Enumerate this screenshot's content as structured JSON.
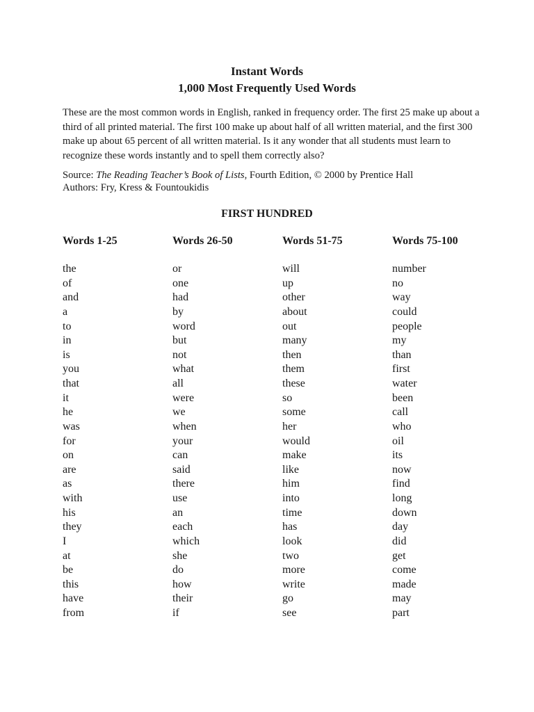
{
  "header": {
    "title": "Instant Words",
    "subtitle": "1,000 Most Frequently Used Words"
  },
  "intro": {
    "text": "These are the most common words in English, ranked in frequency order.  The first 25 make up about a third of all printed material.  The first 100 make up about half of all written material, and the first 300 make up about 65 percent of all written material.  Is it any wonder that all students must learn to recognize these words instantly and to spell them correctly also?"
  },
  "source": {
    "label": "Source: ",
    "book_title": "The Reading Teacher’s Book of Lists",
    "details": ", Fourth Edition, © 2000 by Prentice Hall",
    "authors": "Authors: Fry, Kress & Fountoukidis"
  },
  "section": {
    "title": "FIRST HUNDRED",
    "columns": [
      {
        "header": "Words 1-25",
        "words": [
          "the",
          "of",
          "and",
          "a",
          "to",
          "in",
          "is",
          "you",
          "that",
          "it",
          "he",
          "was",
          "for",
          "on",
          "are",
          "as",
          "with",
          "his",
          "they",
          "I",
          "at",
          "be",
          "this",
          "have",
          "from"
        ]
      },
      {
        "header": "Words 26-50",
        "words": [
          "or",
          "one",
          "had",
          "by",
          "word",
          "but",
          "not",
          "what",
          "all",
          "were",
          "we",
          "when",
          "your",
          "can",
          "said",
          "there",
          "use",
          "an",
          "each",
          "which",
          "she",
          "do",
          "how",
          "their",
          "if"
        ]
      },
      {
        "header": "Words 51-75",
        "words": [
          "will",
          "up",
          "other",
          "about",
          "out",
          "many",
          "then",
          "them",
          "these",
          "so",
          "some",
          "her",
          "would",
          "make",
          "like",
          "him",
          "into",
          "time",
          "has",
          "look",
          "two",
          "more",
          "write",
          "go",
          "see"
        ]
      },
      {
        "header": "Words 75-100",
        "words": [
          "number",
          "no",
          "way",
          "could",
          "people",
          "my",
          "than",
          "first",
          "water",
          "been",
          "call",
          "who",
          "oil",
          "its",
          "now",
          "find",
          "long",
          "down",
          "day",
          "did",
          "get",
          "come",
          "made",
          "may",
          "part"
        ]
      }
    ]
  }
}
